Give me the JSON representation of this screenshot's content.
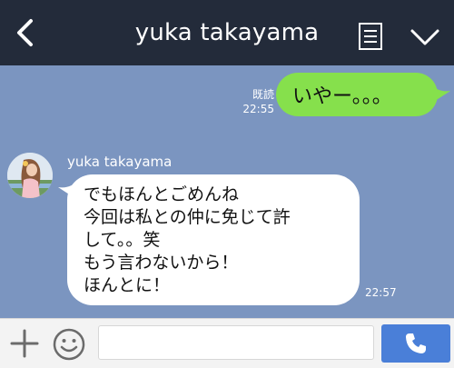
{
  "header": {
    "title": "yuka takayama"
  },
  "messages": {
    "sent": {
      "text": "いやー。。。",
      "read_label": "既読",
      "time": "22:55"
    },
    "received": {
      "sender": "yuka takayama",
      "lines": [
        "でもほんとごめんね",
        "今回は私との仲に免じて許",
        "して。。笑",
        "もう言わないから！",
        "ほんとに！"
      ],
      "time": "22:57"
    }
  },
  "input": {
    "value": "",
    "placeholder": ""
  },
  "colors": {
    "header_bg": "#232b3a",
    "chat_bg": "#7b95c0",
    "sent_bubble": "#86e04c",
    "received_bubble": "#ffffff",
    "call_button": "#4a7fd8"
  },
  "icons": {
    "back": "chevron-left-icon",
    "notes": "notes-icon",
    "menu": "chevron-down-icon",
    "plus": "plus-icon",
    "emoji": "smiley-icon",
    "call": "phone-icon"
  }
}
